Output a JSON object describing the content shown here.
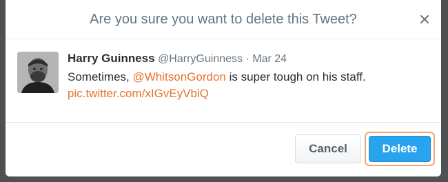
{
  "dialog": {
    "title": "Are you sure you want to delete this Tweet?",
    "close_icon": "close-icon"
  },
  "tweet": {
    "author_name": "Harry Guinness",
    "handle": "@HarryGuinness",
    "separator": "·",
    "date": "Mar 24",
    "text_before": "Sometimes, ",
    "mention": "@WhitsonGordon",
    "text_after": " is super tough on his staff.",
    "pic_link": "pic.twitter.com/xIGvEyVbiQ"
  },
  "buttons": {
    "cancel_label": "Cancel",
    "delete_label": "Delete"
  },
  "colors": {
    "link": "#e8722c",
    "primary": "#2aa3ef",
    "focus_ring": "#f5a46d"
  }
}
